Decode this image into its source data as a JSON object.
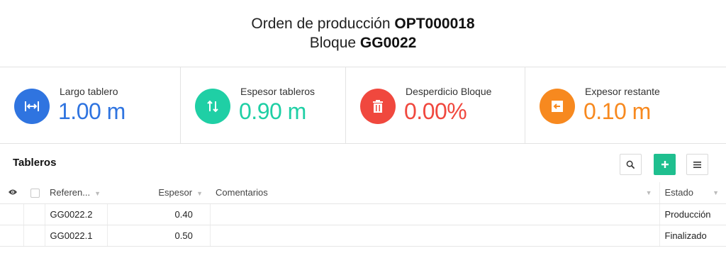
{
  "header": {
    "order_label": "Orden de producción",
    "order_code": "OPT000018",
    "block_label": "Bloque",
    "block_code": "GG0022"
  },
  "stats": [
    {
      "label": "Largo tablero",
      "value": "1.00 m",
      "color": "#2f74e0",
      "icon": "horizontal-arrows-icon"
    },
    {
      "label": "Espesor tableros",
      "value": "0.90 m",
      "color": "#1fcfa5",
      "icon": "vertical-arrows-icon"
    },
    {
      "label": "Desperdicio Bloque",
      "value": "0.00%",
      "color": "#f0483e",
      "icon": "trash-icon"
    },
    {
      "label": "Expesor restante",
      "value": "0.10 m",
      "color": "#f7891f",
      "icon": "exit-arrow-icon"
    }
  ],
  "table_section": {
    "title": "Tableros",
    "columns": {
      "reference": "Referen...",
      "thickness": "Espesor",
      "comments": "Comentarios",
      "status": "Estado"
    },
    "rows": [
      {
        "reference": "GG0022.2",
        "thickness": "0.40",
        "comments": "",
        "status": "Producción"
      },
      {
        "reference": "GG0022.1",
        "thickness": "0.50",
        "comments": "",
        "status": "Finalizado"
      }
    ]
  }
}
